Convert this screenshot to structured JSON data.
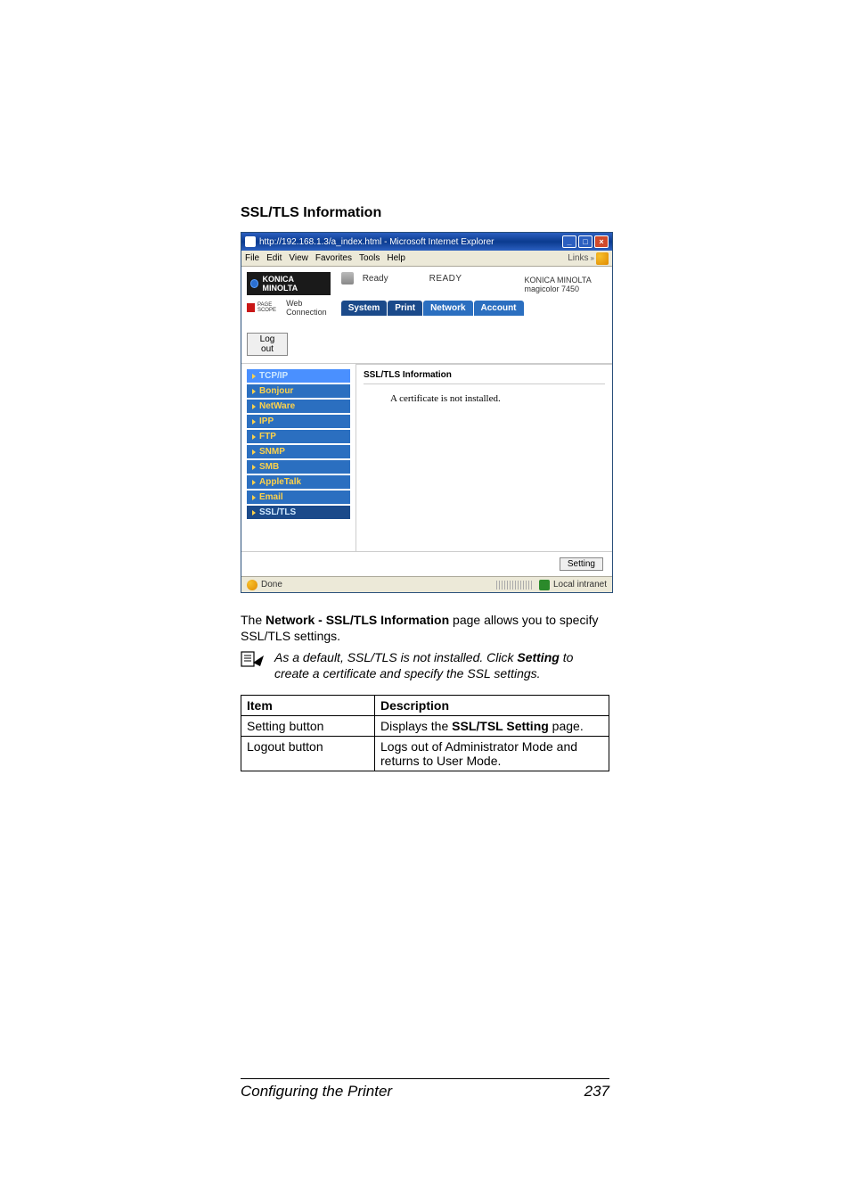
{
  "section_title": "SSL/TLS Information",
  "ie": {
    "title": "http://192.168.1.3/a_index.html - Microsoft Internet Explorer",
    "menus": {
      "file": "File",
      "edit": "Edit",
      "view": "View",
      "favorites": "Favorites",
      "tools": "Tools",
      "help": "Help"
    },
    "links_label": "Links",
    "brand": "KONICA MINOLTA",
    "pagescope": "Web Connection",
    "pagescope_prefix": "PAGE SCOPE",
    "logout": "Log out",
    "ready_small": "Ready",
    "ready_big": "READY",
    "brand_right": "KONICA MINOLTA",
    "model": "magicolor 7450",
    "tabs": {
      "system": "System",
      "print": "Print",
      "network": "Network",
      "account": "Account"
    },
    "nav": [
      "TCP/IP",
      "Bonjour",
      "NetWare",
      "IPP",
      "FTP",
      "SNMP",
      "SMB",
      "AppleTalk",
      "Email",
      "SSL/TLS"
    ],
    "main_head": "SSL/TLS Information",
    "main_msg": "A certificate is not installed.",
    "setting_btn": "Setting",
    "status_done": "Done",
    "status_zone": "Local intranet"
  },
  "para1_pre": "The ",
  "para1_bold": "Network - SSL/TLS Information",
  "para1_post": " page allows you to specify SSL/TLS settings.",
  "note_pre": "As a default, SSL/TLS is not installed. Click ",
  "note_bold": "Setting",
  "note_post": " to create a certificate and specify the SSL settings.",
  "table": {
    "head_item": "Item",
    "head_desc": "Description",
    "rows": [
      {
        "item": "Setting button",
        "desc_pre": "Displays the ",
        "desc_bold": "SSL/TSL Setting",
        "desc_post": " page."
      },
      {
        "item": "Logout button",
        "desc": "Logs out of Administrator Mode and returns to User Mode."
      }
    ]
  },
  "footer": {
    "left": "Configuring the Printer",
    "right": "237"
  }
}
